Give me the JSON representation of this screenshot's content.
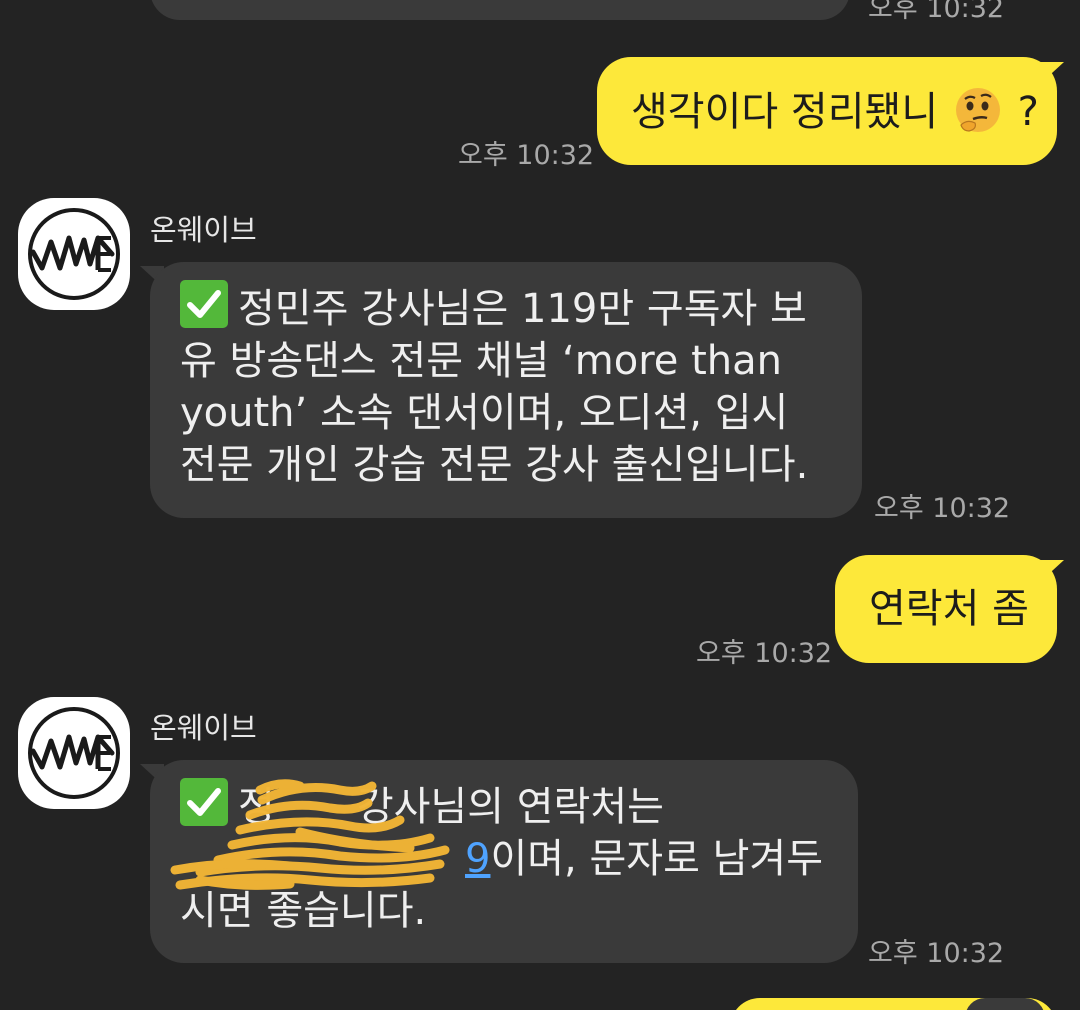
{
  "colors": {
    "background": "#232323",
    "incoming_bubble": "#3a3a3a",
    "outgoing_bubble": "#fde83a",
    "timestamp": "#a9a9a9",
    "link": "#4fa3ff",
    "redaction": "#f2b535"
  },
  "messages": {
    "m0": {
      "time": "오후 10:32"
    },
    "m1": {
      "text": "생각이다 정리됐니",
      "emoji": "thinking-face-icon",
      "suffix": "?",
      "time": "오후 10:32"
    },
    "m2": {
      "sender": "온웨이브",
      "avatar_logo": "WAVE",
      "icon": "check-mark-button-icon",
      "text": "정민주 강사님은 119만 구독자 보유 방송댄스 전문 채널 ‘more than youth’ 소속 댄서이며, 오디션, 입시 전문 개인 강습 전문 강사 출신입니다.",
      "time": "오후 10:32"
    },
    "m3": {
      "text": "연락처 좀",
      "time": "오후 10:32"
    },
    "m4": {
      "sender": "온웨이브",
      "avatar_logo": "WAVE",
      "icon": "check-mark-button-icon",
      "text_before": "정",
      "text_mid": "강사님의 연락처는",
      "link_visible": "9",
      "text_after": "이며, 문자로 남겨두",
      "text_line3": "시면 좋습니다.",
      "time": "오후 10:32"
    }
  }
}
